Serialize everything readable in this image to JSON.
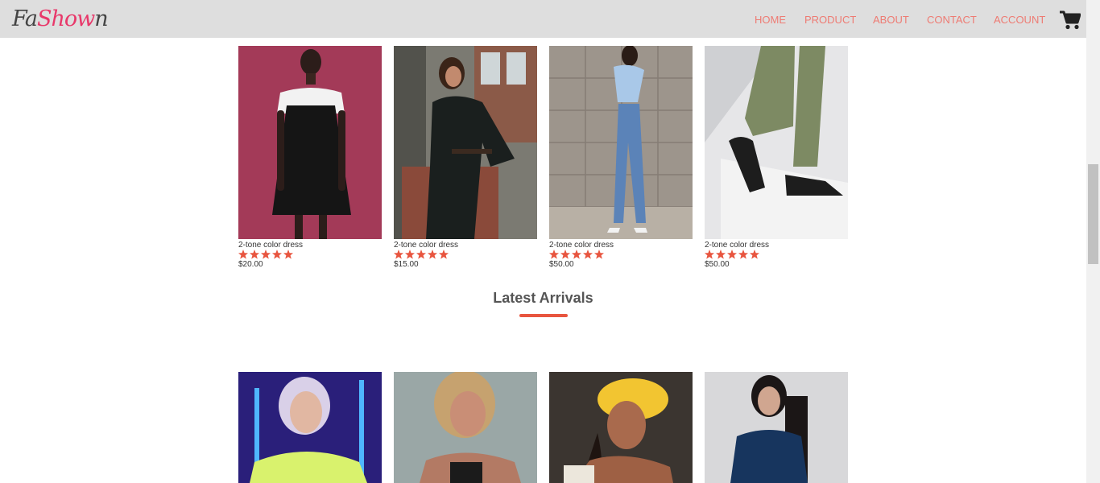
{
  "logo": {
    "part1": "Fa",
    "part2": "Show",
    "part3": "n"
  },
  "nav": {
    "links": [
      "HOME",
      "PRODUCT",
      "ABOUT",
      "CONTACT",
      "ACCOUNT"
    ],
    "cart_icon": "shopping-cart-icon"
  },
  "featured_products": [
    {
      "name": "2-tone color dress",
      "rating": 5,
      "price": "$20.00"
    },
    {
      "name": "2-tone color dress",
      "rating": 5,
      "price": "$15.00"
    },
    {
      "name": "2-tone color dress",
      "rating": 5,
      "price": "$50.00"
    },
    {
      "name": "2-tone color dress",
      "rating": 5,
      "price": "$50.00"
    }
  ],
  "latest": {
    "title": "Latest Arrivals"
  },
  "colors": {
    "nav_link": "#ee7b73",
    "star": "#e8553f",
    "accent": "#e8553f",
    "navbar": "#dedede"
  }
}
